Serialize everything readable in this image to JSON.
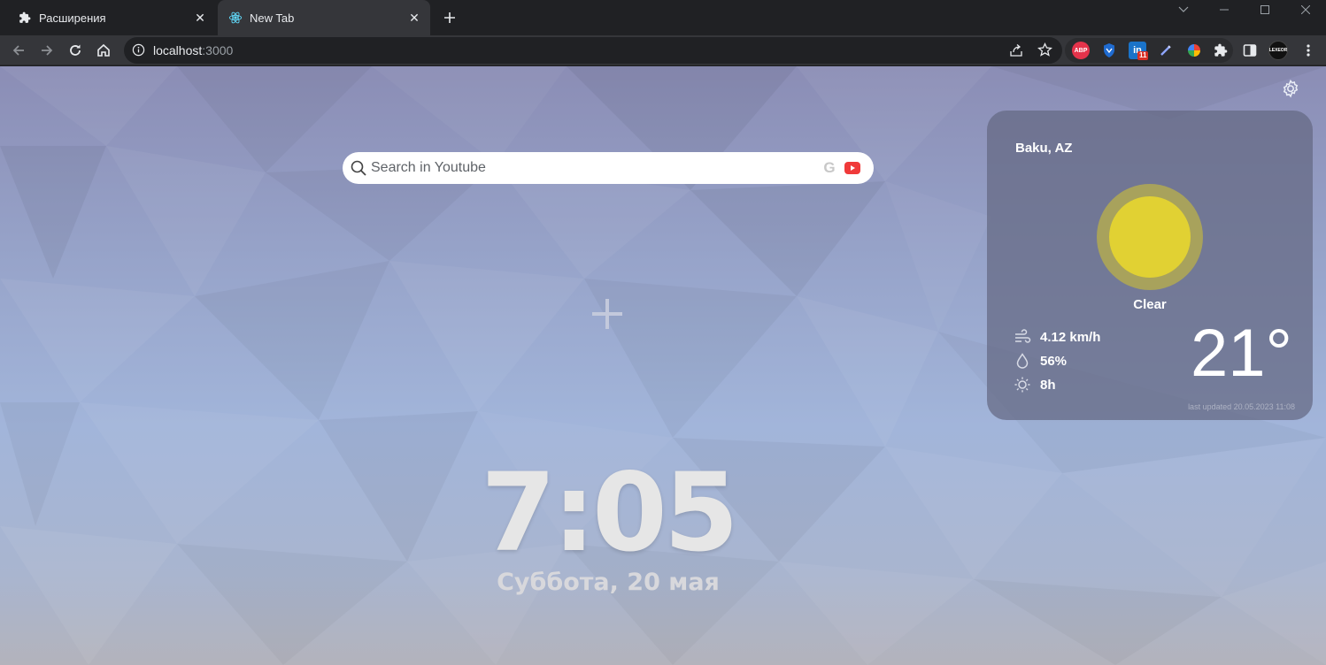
{
  "browser": {
    "tabs": [
      {
        "title": "Расширения",
        "icon": "puzzle-icon",
        "active": false
      },
      {
        "title": "New Tab",
        "icon": "react-icon",
        "active": true
      }
    ],
    "address": {
      "host": "localhost",
      "port": ":3000"
    },
    "extensions": [
      {
        "name": "adblock-plus",
        "label": "ABP",
        "color": "#e4334b"
      },
      {
        "name": "vpn-shield",
        "label": "",
        "color": "#1f6bd0"
      },
      {
        "name": "linkedin",
        "label": "in",
        "badge": "11",
        "color": "#1a73c9"
      },
      {
        "name": "color-picker",
        "label": "",
        "color": "#6f86d6"
      },
      {
        "name": "color-wheel",
        "label": "",
        "color": "#2bb673"
      },
      {
        "name": "lexeor",
        "label": "LEXEOR",
        "color": "#111111"
      }
    ]
  },
  "search": {
    "placeholder": "Search in Youtube",
    "engine_letter": "G"
  },
  "weather": {
    "city": "Baku, AZ",
    "condition": "Clear",
    "wind": "4.12 km/h",
    "humidity": "56%",
    "daylight": "8h",
    "temperature": "21°",
    "updated": "last updated 20.05.2023 11:08",
    "sun_color": "#e1d133"
  },
  "clock": {
    "time": "7:05",
    "date": "Суббота, 20 мая"
  }
}
